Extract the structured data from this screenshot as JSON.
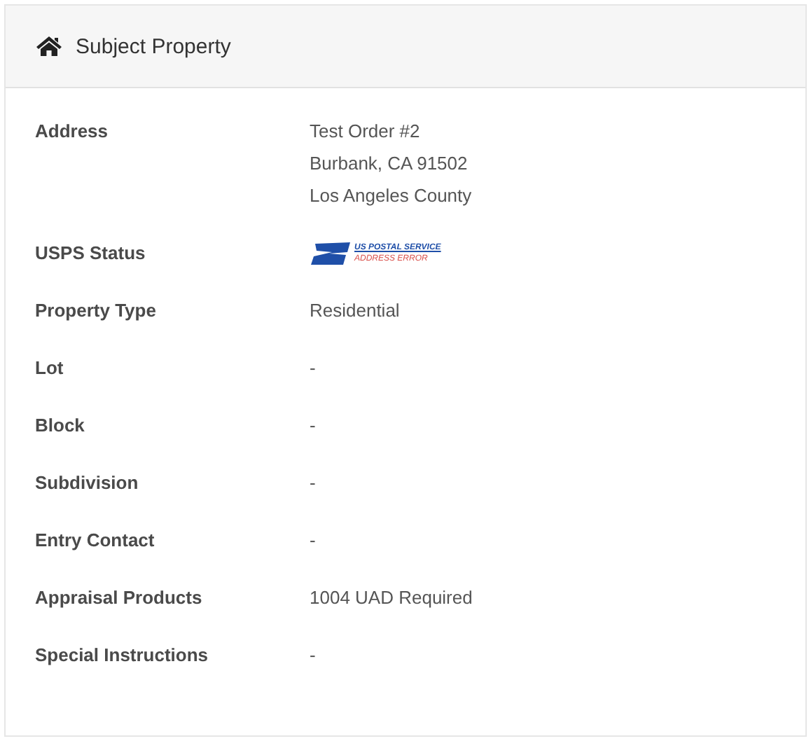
{
  "panel": {
    "title": "Subject Property"
  },
  "rows": [
    {
      "kind": "lines",
      "label": "Address",
      "lines": [
        "Test Order #2",
        "Burbank, CA 91502",
        "Los Angeles County"
      ]
    },
    {
      "kind": "usps",
      "label": "USPS Status",
      "badge": {
        "line_1": "US POSTAL SERVICE",
        "line_2": "ADDRESS ERROR"
      }
    },
    {
      "kind": "text",
      "label": "Property Type",
      "value": "Residential"
    },
    {
      "kind": "text",
      "label": "Lot",
      "value": "-"
    },
    {
      "kind": "text",
      "label": "Block",
      "value": "-"
    },
    {
      "kind": "text",
      "label": "Subdivision",
      "value": "-"
    },
    {
      "kind": "text",
      "label": "Entry Contact",
      "value": "-"
    },
    {
      "kind": "text",
      "label": "Appraisal Products",
      "value": "1004 UAD Required"
    },
    {
      "kind": "text",
      "label": "Special Instructions",
      "value": "-"
    }
  ]
}
